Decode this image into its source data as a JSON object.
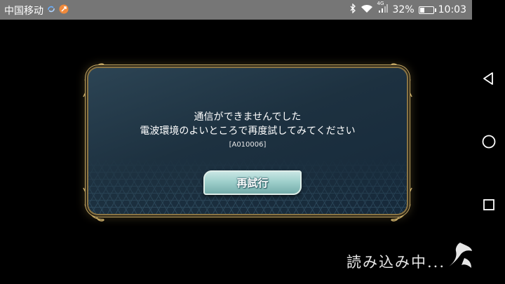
{
  "status_bar": {
    "carrier": "中国移动",
    "network": "4G",
    "battery": "32%",
    "battery_level": 0.32,
    "time": "10:03"
  },
  "dialog": {
    "message_line1": "通信ができませんでした",
    "message_line2": "電波環境のよいところで再度試してみてください",
    "error_code": "[A010006]",
    "retry_label": "再試行"
  },
  "loading_text": "読み込み中...",
  "nav": {
    "back": "back-icon",
    "home": "home-icon",
    "recents": "recents-icon"
  },
  "colors": {
    "gold": "#c3a765",
    "panel": "#1d3140",
    "button": "#9fd0cc",
    "statusbar": "#767676"
  }
}
